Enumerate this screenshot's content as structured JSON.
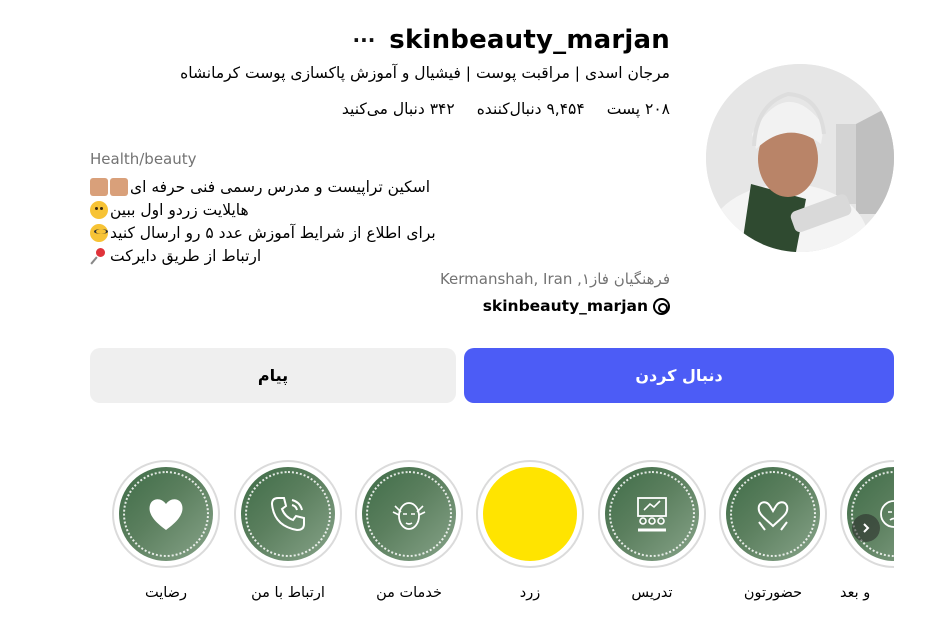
{
  "profile": {
    "username": "skinbeauty_marjan",
    "more_icon": "more-horizontal-icon",
    "full_name": "مرجان اسدی | مراقبت پوست | فیشیال و آموزش پاکسازی پوست کرمانشاه",
    "stats": {
      "posts": "۲۰۸ پست",
      "followers": "۹,۴۵۴ دنبال‌کننده",
      "following": "۳۴۲ دنبال می‌کنید"
    },
    "category": "Health/beauty",
    "bio_lines": [
      "اسکین تراپیست و مدرس رسمی فنی حرفه ای",
      "هایلایت زردو اول ببین",
      "برای اطلاع از شرایط آموزش عدد ۵ رو ارسال کنید",
      "ارتباط از طریق دایرکت"
    ],
    "location": "فرهنگیان فاز۱, Kermanshah, Iran",
    "threads_handle": "skinbeauty_marjan",
    "threads_icon": "threads-icon"
  },
  "actions": {
    "follow_label": "دنبال کردن",
    "message_label": "پیام"
  },
  "highlights": [
    {
      "label": "رضایت",
      "icon": "heart-icon"
    },
    {
      "label": "ارتباط با من",
      "icon": "phone-icon"
    },
    {
      "label": "خدمات من",
      "icon": "facial-icon"
    },
    {
      "label": "زرد",
      "icon": ""
    },
    {
      "label": "تدریس",
      "icon": "teaching-icon"
    },
    {
      "label": "حضورتون",
      "icon": "heart-hands-icon"
    },
    {
      "label": "و بعد",
      "icon": "face-icon"
    }
  ],
  "colors": {
    "follow_bg": "#4c5cf6",
    "message_bg": "#efefef",
    "highlight_green": "#4f7654",
    "highlight_yellow": "#ffe400"
  }
}
